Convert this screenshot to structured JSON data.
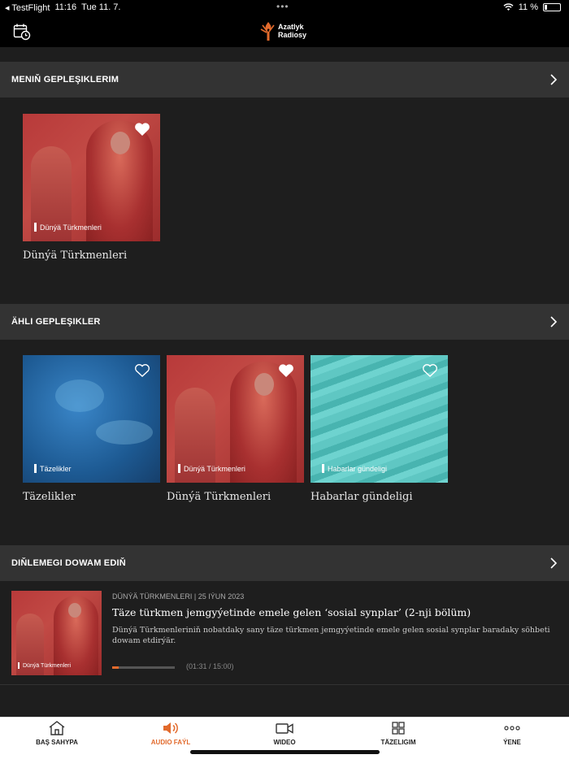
{
  "status_bar": {
    "carrier": "◂ TestFlight",
    "time": "11:16",
    "date": "Tue 11. 7.",
    "battery": "11 %"
  },
  "header": {
    "logo_line1": "Azatlyk",
    "logo_line2": "Radiosy"
  },
  "sections": {
    "my_podcasts": "MENIŇ GEPLEŞIKLERIM",
    "all_podcasts": "ÄHLI GEPLEŞIKLER",
    "continue_listening": "DIŇLEMEGI DOWAM EDIŇ"
  },
  "my_podcasts": [
    {
      "label": "Dünýä Türkmenleri",
      "title": "Dünýä Türkmenleri",
      "favorite": true
    }
  ],
  "all_podcasts": [
    {
      "label": "Täzelikler",
      "title": "Täzelikler",
      "favorite": false
    },
    {
      "label": "Dünýä Türkmenleri",
      "title": "Dünýä Türkmenleri",
      "favorite": true
    },
    {
      "label": "Habarlar gündeligi",
      "title": "Habarlar gündeligi",
      "favorite": false
    }
  ],
  "episode": {
    "thumb_label": "Dünýä Türkmenleri",
    "meta": "DÜNÝÄ TÜRKMENLERI | 25 IÝUN 2023",
    "title": "Täze türkmen jemgyýetinde emele gelen ‘sosial synplar’ (2-nji bölüm)",
    "description": "Dünýä Türkmenleriniň nobatdaky sany täze türkmen jemgyýetinde emele gelen sosial synplar baradaky söhbeti dowam etdirýär.",
    "progress_fraction": 0.1,
    "time": "(01:31 / 15:00)"
  },
  "tabs": [
    {
      "label": "BAŞ SAHYPA",
      "icon": "home-icon",
      "active": false
    },
    {
      "label": "AUDIO FAÝL",
      "icon": "speaker-icon",
      "active": true
    },
    {
      "label": "WIDEO",
      "icon": "video-camera-icon",
      "active": false
    },
    {
      "label": "TÄZELIGIM",
      "icon": "grid-icon",
      "active": false
    },
    {
      "label": "ÝENE",
      "icon": "more-icon",
      "active": false
    }
  ],
  "colors": {
    "accent": "#e26a2c",
    "section_bg": "#333333",
    "page_bg": "#1e1e1e"
  }
}
